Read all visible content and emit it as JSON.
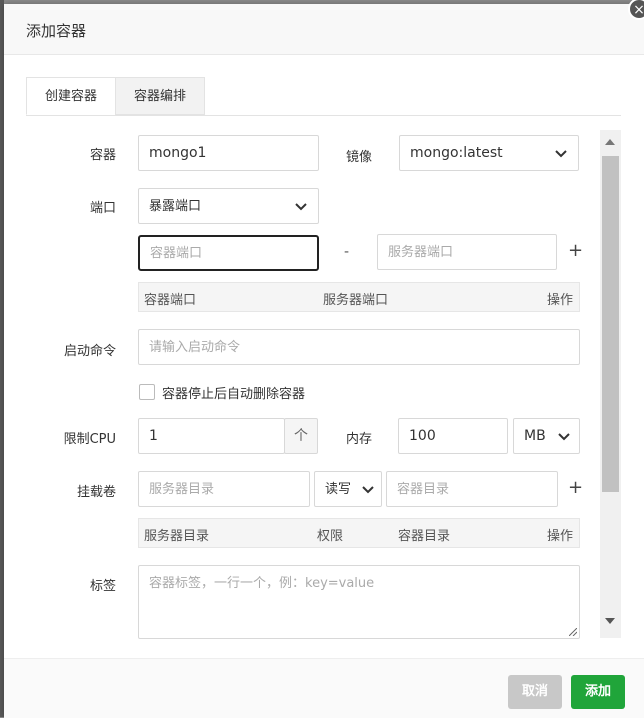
{
  "dialog": {
    "title": "添加容器",
    "close_symbol": "×"
  },
  "tabs": [
    {
      "label": "创建容器",
      "active": true
    },
    {
      "label": "容器编排",
      "active": false
    }
  ],
  "form": {
    "container_label": "容器",
    "container_value": "mongo1",
    "image_label": "镜像",
    "image_value": "mongo:latest",
    "port_label": "端口",
    "port_select": "暴露端口",
    "container_port_placeholder": "容器端口",
    "dash": "-",
    "server_port_placeholder": "服务器端口",
    "add_symbol": "+",
    "port_table": {
      "col1": "容器端口",
      "col2": "服务器端口",
      "col3": "操作"
    },
    "cmd_label": "启动命令",
    "cmd_placeholder": "请输入启动命令",
    "auto_remove_label": "容器停止后自动删除容器",
    "cpu_label": "限制CPU",
    "cpu_value": "1",
    "cpu_unit": "个",
    "mem_label": "内存",
    "mem_value": "100",
    "mem_unit": "MB",
    "volume_label": "挂载卷",
    "server_dir_placeholder": "服务器目录",
    "perm_select": "读写",
    "container_dir_placeholder": "容器目录",
    "volume_table": {
      "col1": "服务器目录",
      "col2": "权限",
      "col3": "容器目录",
      "col4": "操作"
    },
    "tag_label": "标签",
    "tag_placeholder": "容器标签，一行一个，例：key=value"
  },
  "footer": {
    "cancel_label": "取消",
    "add_label": "添加"
  },
  "colors": {
    "accent_green": "#20a53a",
    "cancel_gray": "#c8c8c8"
  }
}
